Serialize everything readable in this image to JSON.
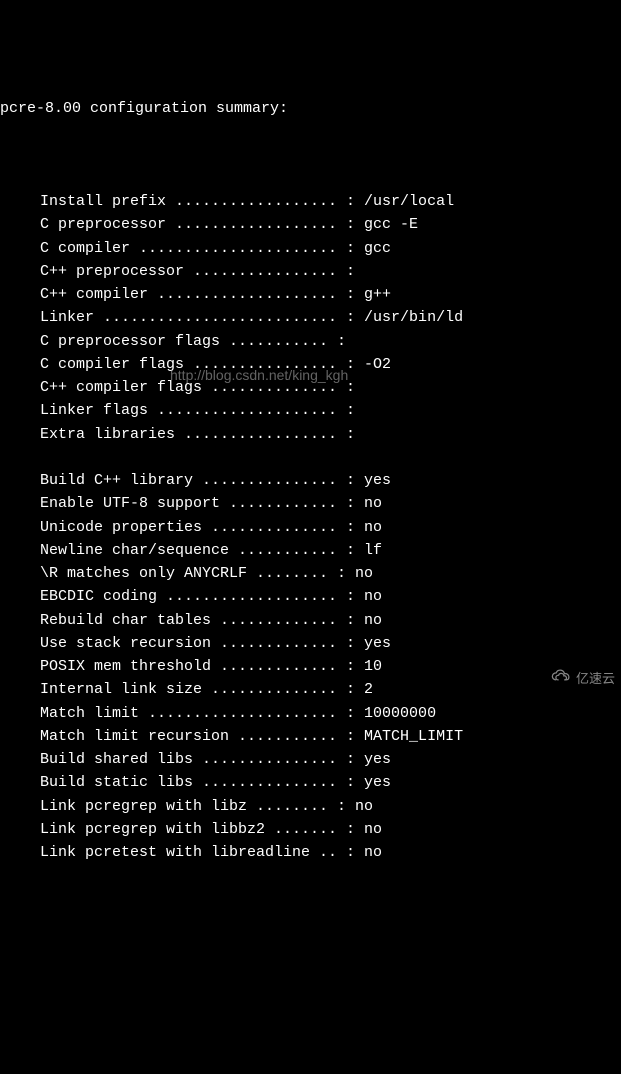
{
  "header": "pcre-8.00 configuration summary:",
  "watermark": "http://blog.csdn.net/king_kgh",
  "logo_text": "亿速云",
  "rows": [
    {
      "label": "Install prefix",
      "dots": "..................",
      "value": "/usr/local"
    },
    {
      "label": "C preprocessor",
      "dots": "..................",
      "value": "gcc -E"
    },
    {
      "label": "C compiler",
      "dots": "......................",
      "value": "gcc"
    },
    {
      "label": "C++ preprocessor",
      "dots": "................",
      "value": ""
    },
    {
      "label": "C++ compiler",
      "dots": "....................",
      "value": "g++"
    },
    {
      "label": "Linker",
      "dots": "..........................",
      "value": "/usr/bin/ld"
    },
    {
      "label": "C preprocessor flags",
      "dots": "...........",
      "value": ""
    },
    {
      "label": "C compiler flags",
      "dots": "................",
      "value": "-O2"
    },
    {
      "label": "C++ compiler flags",
      "dots": "..............",
      "value": ""
    },
    {
      "label": "Linker flags",
      "dots": "....................",
      "value": ""
    },
    {
      "label": "Extra libraries",
      "dots": ".................",
      "value": ""
    },
    {
      "blank": true
    },
    {
      "label": "Build C++ library",
      "dots": "...............",
      "value": "yes"
    },
    {
      "label": "Enable UTF-8 support",
      "dots": "............",
      "value": "no"
    },
    {
      "label": "Unicode properties",
      "dots": "..............",
      "value": "no"
    },
    {
      "label": "Newline char/sequence",
      "dots": "...........",
      "value": "lf"
    },
    {
      "label": "\\R matches only ANYCRLF",
      "dots": "........",
      "value": "no"
    },
    {
      "label": "EBCDIC coding",
      "dots": "...................",
      "value": "no"
    },
    {
      "label": "Rebuild char tables",
      "dots": ".............",
      "value": "no"
    },
    {
      "label": "Use stack recursion",
      "dots": ".............",
      "value": "yes"
    },
    {
      "label": "POSIX mem threshold",
      "dots": ".............",
      "value": "10"
    },
    {
      "label": "Internal link size",
      "dots": "..............",
      "value": "2"
    },
    {
      "label": "Match limit",
      "dots": ".....................",
      "value": "10000000"
    },
    {
      "label": "Match limit recursion",
      "dots": "...........",
      "value": "MATCH_LIMIT"
    },
    {
      "label": "Build shared libs",
      "dots": "...............",
      "value": "yes"
    },
    {
      "label": "Build static libs",
      "dots": "...............",
      "value": "yes"
    },
    {
      "label": "Link pcregrep with libz",
      "dots": "........",
      "value": "no"
    },
    {
      "label": "Link pcregrep with libbz2",
      "dots": ".......",
      "value": "no"
    },
    {
      "label": "Link pcretest with libreadline",
      "dots": "..",
      "value": "no"
    }
  ]
}
